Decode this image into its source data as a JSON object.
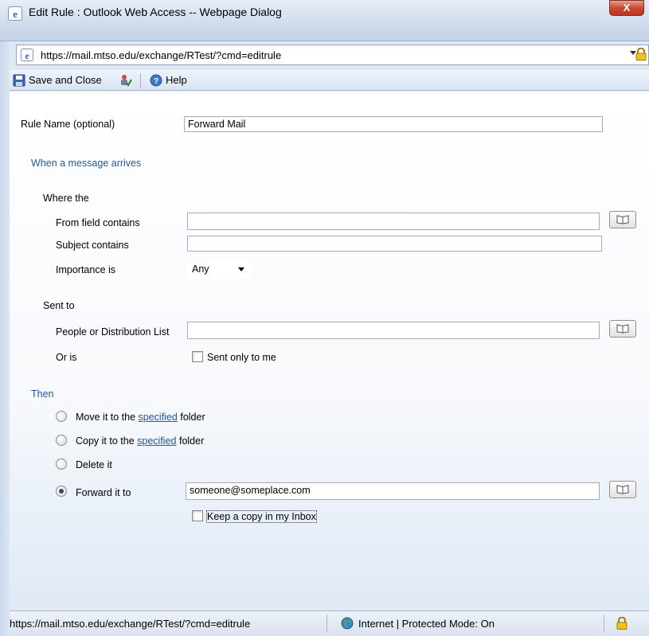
{
  "window": {
    "title": "Edit Rule : Outlook Web Access -- Webpage Dialog",
    "close_label": "X"
  },
  "address": {
    "url": "https://mail.mtso.edu/exchange/RTest/?cmd=editrule"
  },
  "toolbar": {
    "save_label": "Save and Close",
    "help_label": "Help"
  },
  "form": {
    "rule_name_label": "Rule Name  (optional)",
    "rule_name_value": "Forward Mail",
    "when_section": "When a message arrives",
    "where_label": "Where the",
    "from_label": "From field contains",
    "from_value": "",
    "subject_label": "Subject contains",
    "subject_value": "",
    "importance_label": "Importance is",
    "importance_value": "Any",
    "sent_to_label": "Sent to",
    "people_label": "People or Distribution List",
    "people_value": "",
    "or_is_label": "Or is",
    "sent_only_label": "Sent only to me",
    "then_section": "Then",
    "move_prefix": "Move it to the",
    "move_link": "specified",
    "move_suffix": "folder",
    "copy_prefix": "Copy it to the",
    "copy_link": "specified",
    "copy_suffix": "folder",
    "delete_label": "Delete it",
    "forward_label": "Forward it to",
    "forward_value": "someone@someplace.com",
    "keep_copy_label": "Keep a copy in my Inbox"
  },
  "status": {
    "url": "https://mail.mtso.edu/exchange/RTest/?cmd=editrule",
    "zone": "Internet | Protected Mode: On"
  }
}
